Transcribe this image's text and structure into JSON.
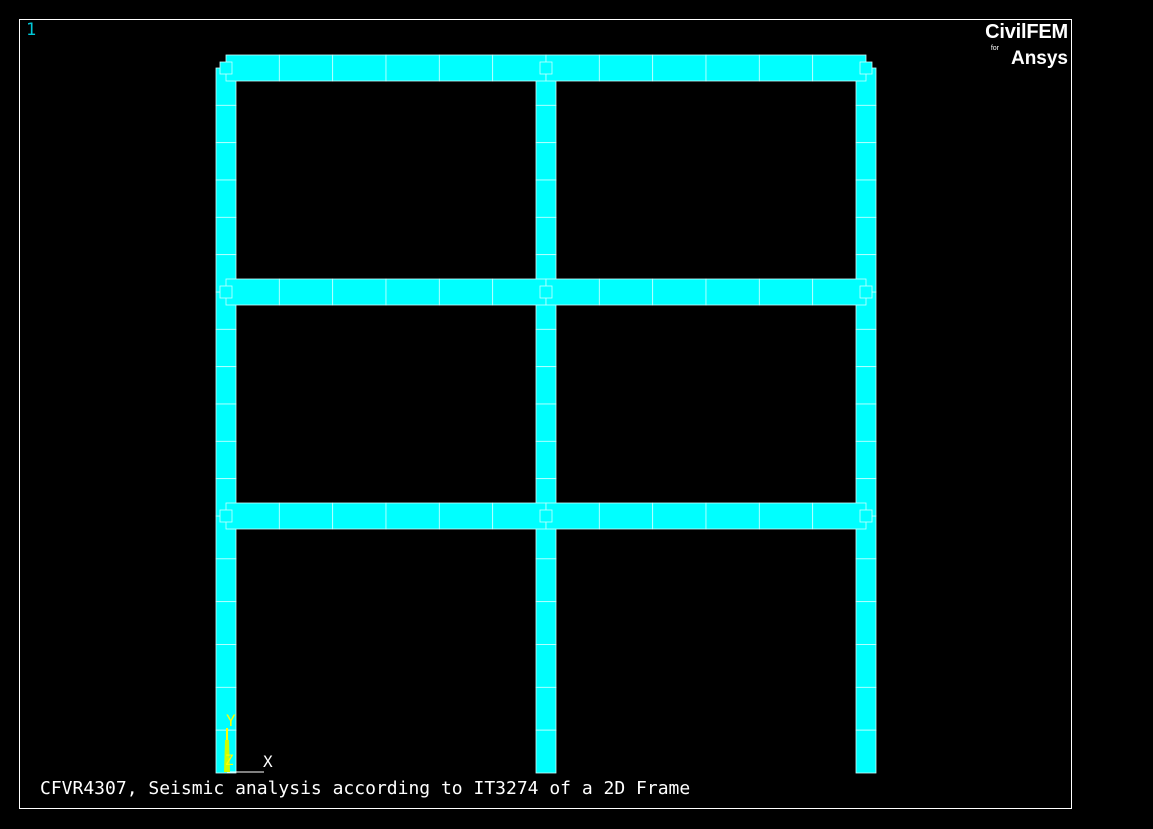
{
  "viewport": {
    "window_number": "1",
    "background_color": "#000000",
    "frame_color": "#ffffff"
  },
  "logo": {
    "main": "CivilFEM",
    "for": "for",
    "sub": "Ansys"
  },
  "model": {
    "element_color": "#00ffff",
    "edge_color": "#c8ffff",
    "columns": 3,
    "stories": 3,
    "beam_divisions_per_bay": 6,
    "column_divisions_per_story": 6
  },
  "triad": {
    "x_label": "X",
    "y_label": "Y",
    "z_label": "Z",
    "axis_color": "#ffff00"
  },
  "title": {
    "text": "CFVR4307, Seismic analysis according to IT3274 of a 2D Frame"
  }
}
